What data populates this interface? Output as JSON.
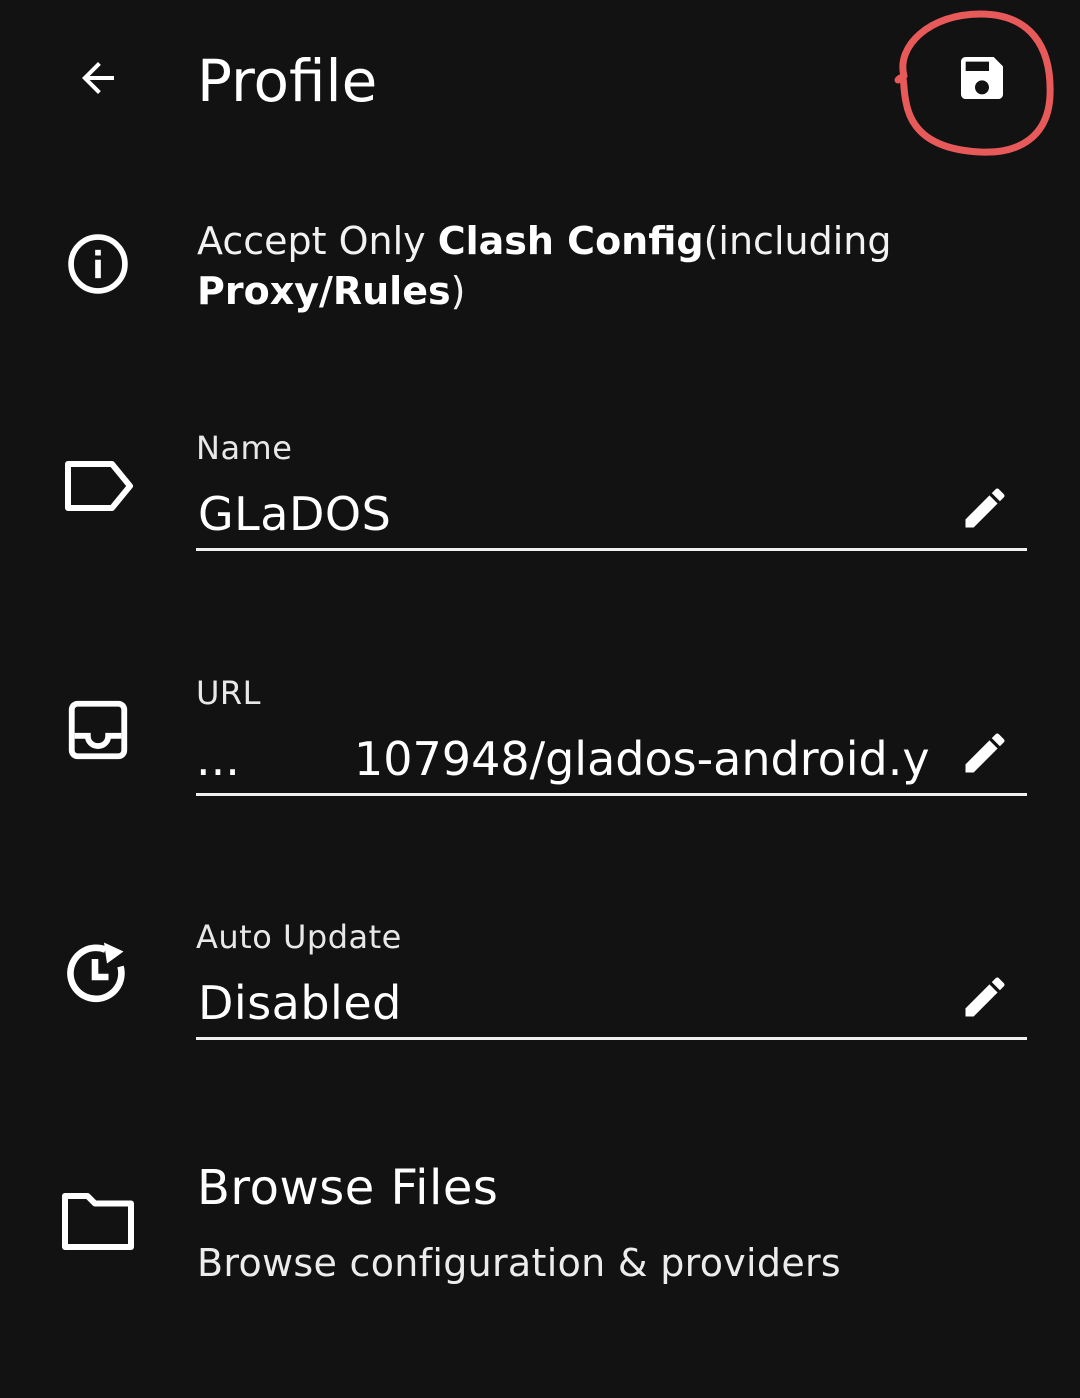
{
  "appbar": {
    "title": "Profile",
    "back_icon": "arrow-back-icon",
    "save_icon": "save-floppy-icon",
    "highlight_color": "#e85a5a"
  },
  "tip": {
    "icon": "info-icon",
    "segments": [
      {
        "text": "Accept Only ",
        "bold": false
      },
      {
        "text": "Clash Config",
        "bold": true
      },
      {
        "text": "(including ",
        "bold": false
      },
      {
        "text": "Proxy/Rules",
        "bold": true
      },
      {
        "text": ")",
        "bold": false
      }
    ]
  },
  "fields": {
    "name": {
      "icon": "label-tag-icon",
      "label": "Name",
      "value": "GLaDOS",
      "edit_icon": "pencil-edit-icon"
    },
    "url": {
      "icon": "inbox-tray-icon",
      "label": "URL",
      "ellipsis": "...",
      "value": "107948/glados-android.y",
      "edit_icon": "pencil-edit-icon"
    },
    "auto_update": {
      "icon": "update-clock-icon",
      "label": "Auto Update",
      "value": "Disabled",
      "edit_icon": "pencil-edit-icon"
    }
  },
  "browse": {
    "icon": "folder-icon",
    "title": "Browse Files",
    "subtitle": "Browse configuration & providers"
  },
  "colors": {
    "background": "#121212",
    "text": "#ffffff"
  }
}
